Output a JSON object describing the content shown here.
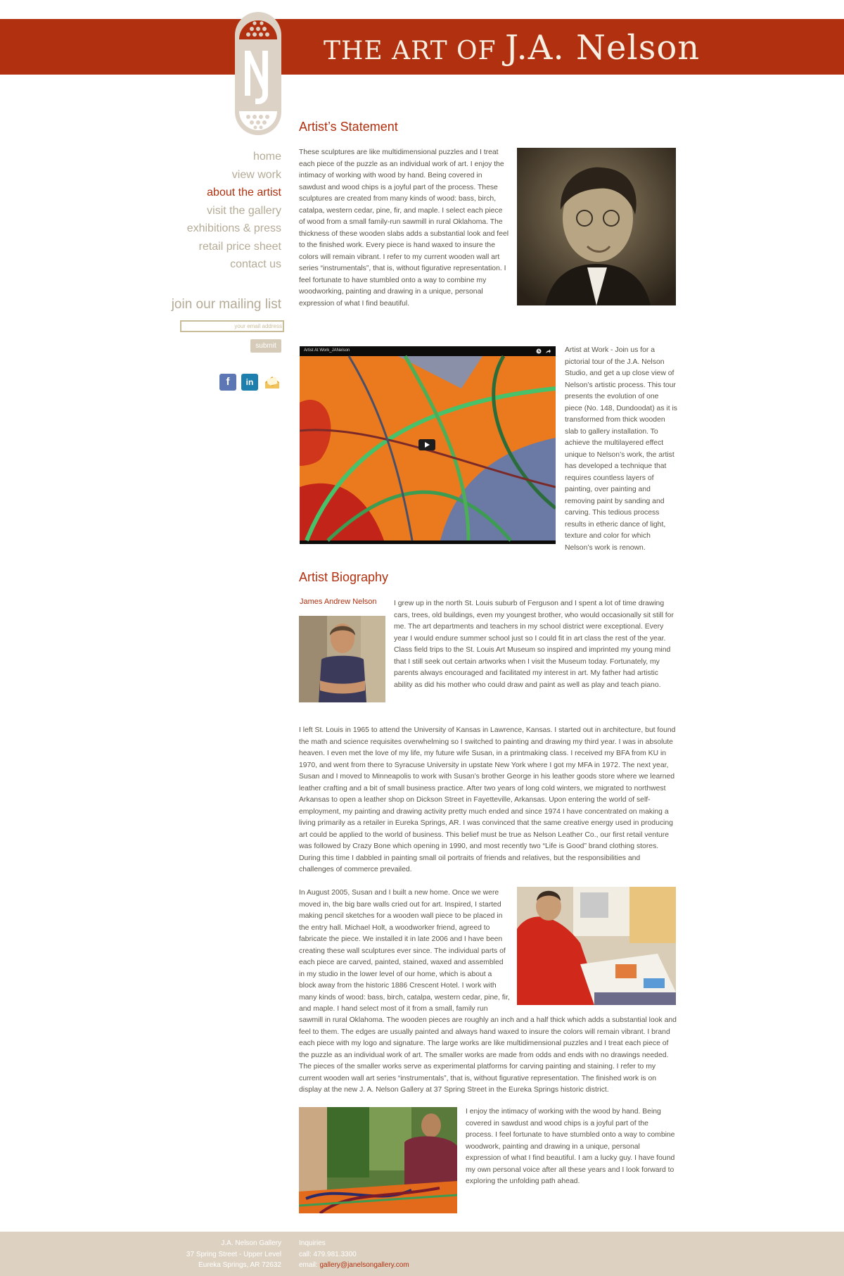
{
  "header": {
    "title_prefix": "THE ART OF",
    "title_name": "J.A. Nelson",
    "logo_icon": "jn-monogram-logo-icon",
    "brand_color": "#b1300f"
  },
  "nav": {
    "items": [
      {
        "label": "home"
      },
      {
        "label": "view work"
      },
      {
        "label": "about the artist"
      },
      {
        "label": "visit the gallery"
      },
      {
        "label": "exhibitions & press"
      },
      {
        "label": "retail price sheet"
      },
      {
        "label": "contact us"
      }
    ],
    "active": "about the artist"
  },
  "mailing": {
    "title": "join our mailing list",
    "placeholder": "your email address",
    "submit_label": "submit"
  },
  "social": [
    {
      "icon": "facebook-icon",
      "glyph": "f"
    },
    {
      "icon": "linkedin-icon",
      "glyph": "in"
    },
    {
      "icon": "email-icon",
      "glyph": ""
    }
  ],
  "statement": {
    "title": "Artist’s Statement",
    "text": "These sculptures are like multidimensional puzzles and I treat each piece of the puzzle as an individual work of art. I enjoy the intimacy of working with wood by hand. Being covered in sawdust and wood chips is a joyful part of the process. These sculptures are created from many kinds of wood: bass, birch, catalpa, western cedar, pine, fir, and maple. I select each piece of wood from a small family-run sawmill in rural Oklahoma. The thickness of these wooden slabs adds a substantial look and feel to the finished work. Every piece is hand waxed to insure the colors will remain vibrant. I refer to my current wooden wall art series “instrumentals”, that is, without figurative representation. I feel fortunate to have stumbled onto a way to combine my woodworking, painting and drawing in a unique, personal expression of what I find beautiful."
  },
  "video": {
    "title": "Artist At Work_JANelson",
    "description": "Artist at Work - Join us for a pictorial tour of the J.A. Nelson Studio, and get a up close view of Nelson’s artistic process. This tour presents the evolution of one piece (No. 148, Dundoodat) as it is transformed from thick wooden slab to gallery installation. To achieve the multilayered effect unique to Nelson’s work, the artist has developed a technique that requires countless layers of painting, over painting and removing paint by sanding and carving. This tedious process results in etheric dance of light, texture and color for which Nelson’s work is renown."
  },
  "biography": {
    "title": "Artist Biography",
    "name": "James Andrew Nelson",
    "p1": "I grew up in the north St. Louis suburb of Ferguson and I spent a lot of time drawing cars, trees, old buildings, even my youngest brother, who would occasionally sit still for me. The art departments and teachers in my school district were exceptional. Every year I would endure summer school just so I could fit in art class the rest of the year. Class field trips to the St. Louis Art Museum so inspired and imprinted my young mind that I still seek out certain artworks when I visit the Museum today. Fortunately, my parents always encouraged and facilitated my interest in art. My father had artistic ability as did his mother who could draw and paint as well as play and teach piano.",
    "p2": "I left St. Louis in 1965 to attend the University of Kansas in Lawrence, Kansas. I started out in architecture, but found the math and science requisites overwhelming so I switched to painting and drawing my third year. I was in absolute heaven. I even met the love of my life, my future wife Susan, in a printmaking class. I received my BFA from KU in 1970, and went from there to Syracuse University in upstate New York where I got my MFA in 1972. The next year, Susan and I moved to Minneapolis to work with Susan’s brother George in his leather goods store where we learned leather crafting and a bit of small business practice. After two years of long cold winters, we migrated to northwest Arkansas to open a leather shop on Dickson Street in Fayetteville, Arkansas. Upon entering the world of self-employment, my painting and drawing activity pretty much ended and since 1974 I have concentrated on making a living primarily as a retailer in Eureka Springs, AR. I was convinced that the same creative energy used in producing art could be applied to the world of business. This belief must be true as Nelson Leather Co., our first retail venture was followed by Crazy Bone which opening in 1990, and most recently two “Life is Good” brand clothing stores. During this time I dabbled in painting small oil portraits of friends and relatives, but the responsibilities and challenges of commerce prevailed.",
    "p3_wrap": "In August 2005, Susan and I built a new home. Once we were moved in, the big bare walls cried out for art. Inspired, I started making pencil sketches for a wooden wall piece to be placed in the entry hall. Michael Holt, a woodworker friend, agreed to fabricate the piece.  We installed it in late 2006 and I have been creating these wall sculptures ever since. The individual parts of each piece are carved, painted, stained, waxed and assembled in my studio in the lower level of our home, which is about a block away from the historic 1886 Crescent Hotel. I work with many kinds of wood: bass, birch, catalpa, western cedar, pine, fir, and maple. I hand select most of it from a small, family run",
    "p3_rest": "sawmill in rural Oklahoma. The wooden pieces are roughly an inch and a half thick which adds a substantial look and feel to them. The edges are usually painted and always hand waxed to insure the colors will remain vibrant. I brand each piece with my logo and signature. The large works are like multidimensional puzzles and I treat each piece of the puzzle as an individual work of art. The smaller works are made from odds and ends with no drawings needed. The pieces of the smaller works serve as experimental platforms for carving painting and staining. I refer to my current wooden wall art series “instrumentals”, that is, without figurative representation. The finished work is on display at the new J. A. Nelson Gallery at 37 Spring Street in the Eureka Springs historic district.",
    "p4": "I enjoy the intimacy of working with the wood by hand. Being covered in sawdust and wood chips is a joyful part of the process. I feel fortunate to have stumbled onto a way to combine woodwork, painting and drawing in a unique, personal expression of what I find beautiful. I am a lucky guy. I have found my own personal voice after all these years and I look forward to exploring the unfolding path ahead."
  },
  "footer": {
    "gallery_name": "J.A. Nelson Gallery",
    "street": "37 Spring Street - Upper Level",
    "city": "Eureka Springs, AR 72632",
    "inquiries_label": "Inquiries",
    "call": "call: 479.981.3300",
    "email_label": "email: ",
    "email": "gallery@janelsongallery.com",
    "background_color": "#ddd2c2"
  }
}
